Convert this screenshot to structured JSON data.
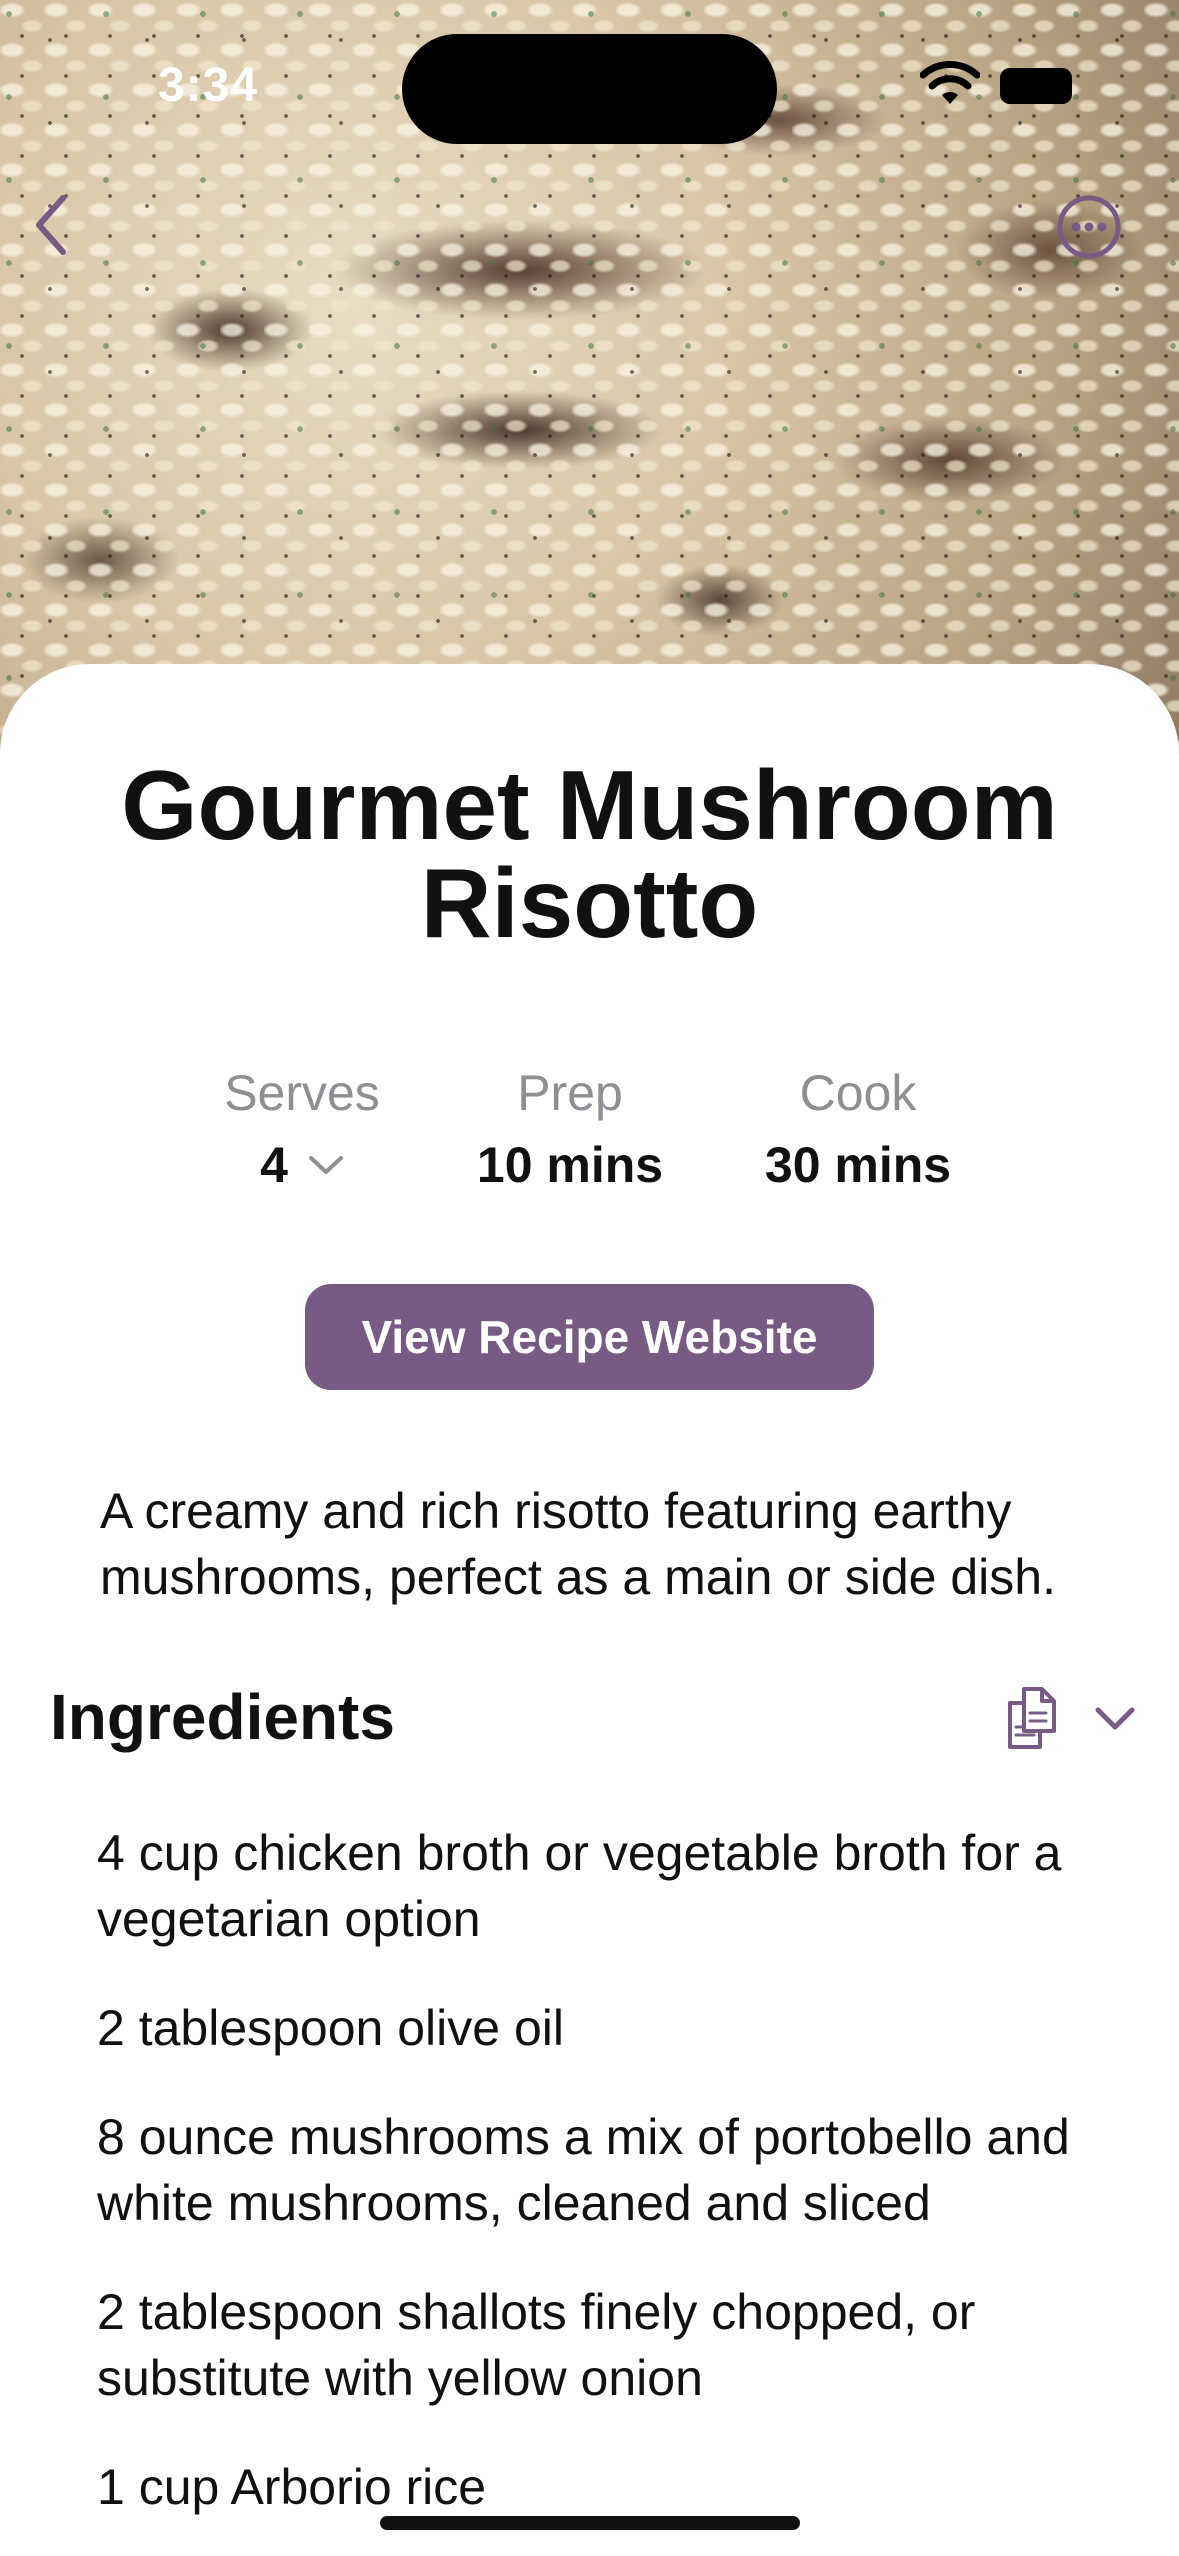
{
  "status_bar": {
    "time": "3:34"
  },
  "nav": {
    "back_icon": "chevron-left-icon",
    "more_icon": "ellipsis-circle-icon"
  },
  "recipe": {
    "title": "Gourmet Mushroom Risotto",
    "serves_label": "Serves",
    "serves_value": "4",
    "prep_label": "Prep",
    "prep_value": "10 mins",
    "cook_label": "Cook",
    "cook_value": "30 mins",
    "website_button": "View Recipe Website",
    "description": "A creamy and rich risotto featuring earthy mushrooms, perfect as a main or side dish."
  },
  "ingredients_section": {
    "title": "Ingredients",
    "copy_icon": "copy-icon",
    "collapse_icon": "chevron-down-icon",
    "items": [
      "4 cup chicken broth or vegetable broth for a vegetarian option",
      "2 tablespoon olive oil",
      "8 ounce mushrooms a mix of portobello and white mushrooms, cleaned and sliced",
      "2 tablespoon shallots finely chopped, or substitute with yellow onion",
      "1 cup Arborio rice"
    ]
  },
  "colors": {
    "accent": "#775b84",
    "secondary_text": "#8e8e93",
    "primary_text": "#111111"
  }
}
